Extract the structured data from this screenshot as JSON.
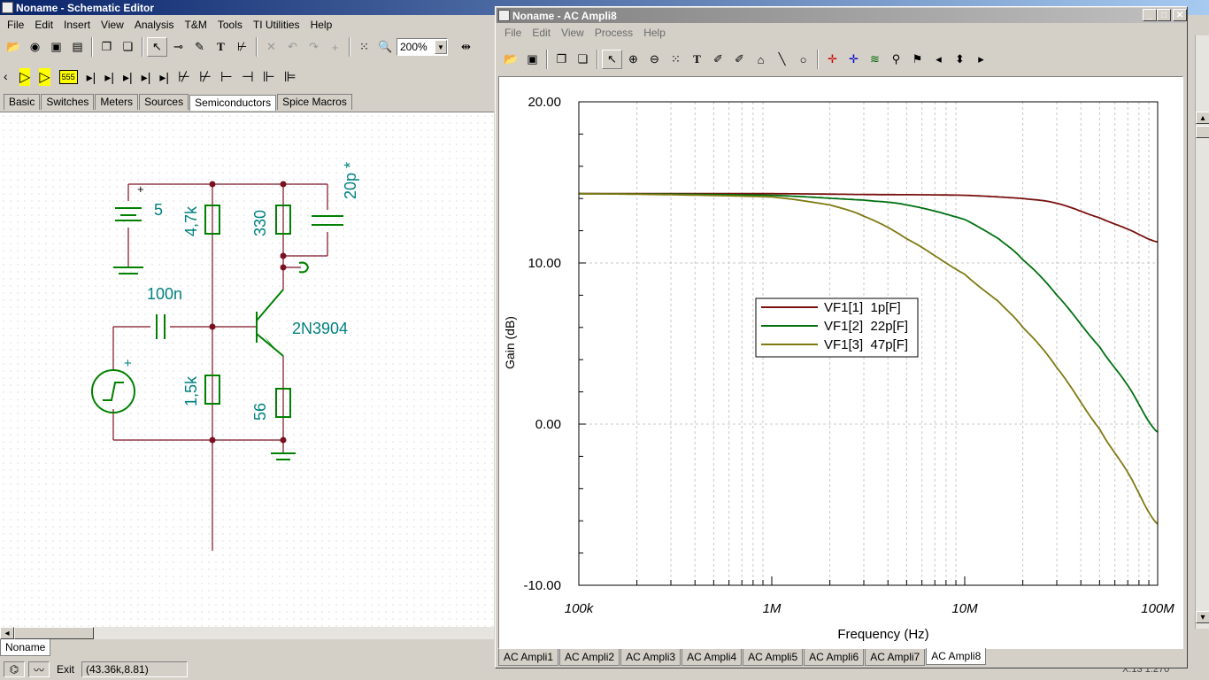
{
  "editor": {
    "title": "Noname - Schematic Editor",
    "menu": [
      "File",
      "Edit",
      "Insert",
      "View",
      "Analysis",
      "T&M",
      "Tools",
      "TI Utilities",
      "Help"
    ],
    "zoom": "200%",
    "component_tabs": [
      "Basic",
      "Switches",
      "Meters",
      "Sources",
      "Semiconductors",
      "Spice Macros"
    ],
    "active_component_tab": "Semiconductors",
    "doc_tab": "Noname",
    "status_exit": "Exit",
    "status_coords": "(43.36k,8.81)",
    "components": {
      "battery": "5",
      "r_top": "4,7k",
      "r_collector": "330",
      "cap_miller": "20p *",
      "cap_input": "100n",
      "transistor": "2N3904",
      "r_bottom": "1,5k",
      "r_emitter": "56",
      "battery_plus": "+",
      "source_plus": "+"
    }
  },
  "analysis_window": {
    "title": "Noname - AC Ampli8",
    "menu": [
      "File",
      "Edit",
      "View",
      "Process",
      "Help"
    ],
    "bottom_tabs": [
      "AC Ampli1",
      "AC Ampli2",
      "AC Ampli3",
      "AC Ampli4",
      "AC Ampli5",
      "AC Ampli6",
      "AC Ampli7",
      "AC Ampli8"
    ],
    "active_tab": "AC Ampli8",
    "status_right": "X:13 1.270"
  },
  "chart_data": {
    "type": "line",
    "xlabel": "Frequency (Hz)",
    "ylabel": "Gain (dB)",
    "x_scale": "log",
    "xlim": [
      100000,
      100000000
    ],
    "ylim": [
      -10,
      20
    ],
    "x_ticks": [
      "100k",
      "1M",
      "10M",
      "100M"
    ],
    "y_ticks": [
      "20.00",
      "10.00",
      "0.00",
      "-10.00"
    ],
    "grid": true,
    "legend_placement": "center",
    "series": [
      {
        "name": "VF1[1]  1p[F]",
        "color": "#7a1010",
        "x": [
          100000,
          1000000,
          3000000,
          10000000,
          20000000,
          30000000,
          50000000,
          70000000,
          100000000
        ],
        "y": [
          14.3,
          14.3,
          14.25,
          14.2,
          14.0,
          13.7,
          12.8,
          12.1,
          11.3
        ]
      },
      {
        "name": "VF1[2]  22p[F]",
        "color": "#007010",
        "x": [
          100000,
          1000000,
          3000000,
          5000000,
          10000000,
          15000000,
          20000000,
          30000000,
          50000000,
          70000000,
          100000000
        ],
        "y": [
          14.3,
          14.2,
          13.9,
          13.6,
          12.7,
          11.5,
          10.2,
          8.0,
          4.8,
          2.4,
          -0.5
        ]
      },
      {
        "name": "VF1[3]  47p[F]",
        "color": "#7f7a10",
        "x": [
          100000,
          1000000,
          2000000,
          3000000,
          5000000,
          10000000,
          15000000,
          20000000,
          30000000,
          50000000,
          70000000,
          100000000
        ],
        "y": [
          14.3,
          14.1,
          13.6,
          12.9,
          11.5,
          9.3,
          7.6,
          6.0,
          3.5,
          -0.3,
          -3.0,
          -6.2
        ]
      }
    ]
  }
}
